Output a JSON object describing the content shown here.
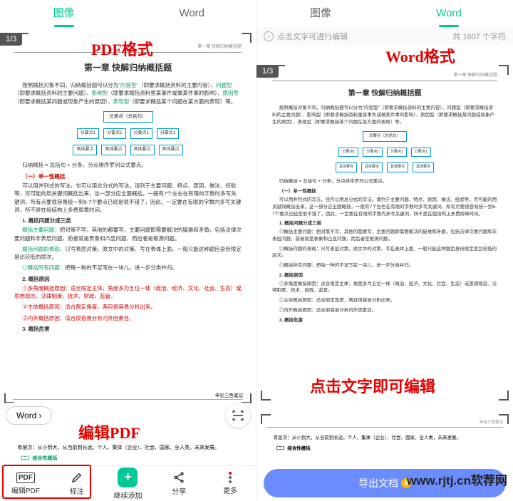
{
  "annotations": {
    "pdf_format": "PDF格式",
    "word_format": "Word格式",
    "click_to_edit": "点击文字即可编辑",
    "edit_pdf": "编辑PDF"
  },
  "watermark": "www.rjtj.cn软荐网",
  "left": {
    "tabs": {
      "image": "图像",
      "word": "Word",
      "active": "image"
    },
    "page_indicator": "1/3",
    "word_chip": "Word",
    "doc": {
      "header_line": "第一章  快解归纳概括题",
      "title": "第一章  快解归纳概括题",
      "intro": "按照概括对象不同，归纳概括题可以分为",
      "type1": "\"内容型\"",
      "type1_desc": "（即要求概括资料的主要内容）、",
      "type2": "问题型",
      "type2_desc": "（即要求概括资料的主要问题）、",
      "type3": "影响型",
      "type3_desc": "（即要求概括资料里某事件或做某件事的影响）、",
      "type4": "原因型",
      "type4_desc": "（即要求概括某问题或现象产生的原因）、",
      "type5": "表现型",
      "type5_desc": "（即要求概括某个问题在某方面的表现）等。",
      "diagram": {
        "top": "总要点（总括句）",
        "row2": [
          "分要点1",
          "分要点1",
          "分要点1",
          "分要点1"
        ],
        "row3": [
          "具体要点",
          "具体要点",
          "具体要点",
          "具体要点"
        ]
      },
      "formula": "归纳概括 = 总括句 + 分条，分点排序罗列公式要点。",
      "sec1": "（一）单一性概括",
      "sec1_p1": "可以用并列式的写法，也可以用总分式的写法。请列于主要问题、特点、原因、做法、经验等，尽可能的用关键词概括出来，这一部分应全面概括，一般有7个左右在有限的字数时多写关键词，所有点要很容易统一到6-7个要点已经是很不错了，因此，一定要在有限的字数内多写关键词，所不是在组结构上多费周章时间。",
      "sec2": "1. 概括问题分成三类",
      "sec2_l1_a": "概括主要问题：",
      "sec2_l1_b": "把对策不写，其他的都要写，主要问题即需要解决的疑难和矛盾，包括法律次要问题和非表层问题，前者就是表象和凸显问题，而后者是根源问题。",
      "sec2_l2_a": "概括问题的表现：",
      "sec2_l2_b": "只写表层对策，原文中的对策、写在表体上面、一般只能这种题目身份限定是比较低的层次。",
      "sec2_l3_a": "◎概括所有问题：",
      "sec2_l3_b": "把每一种的不足写在一块儿，进一步分类并归。",
      "sec3": "2. 概括原因",
      "sec3_l1": "①多角度概括原因：适合限定主体，角度多为五位一体（政治、经济、文化、社会、生态）或思想观念、法律制度、技术、财政、监管。",
      "sec3_l2": "②主体概括原因：适合限定角度，两目很容易分析出来。",
      "sec3_l3": "③内外概括原因：适合很容易分析内外因素目。",
      "sec4": "3. 概括危害",
      "note_title": "申论三色笔记",
      "p_last": "有层次：从小到大，从当前到长远。个人、集体（企业）、社会、国家、全人类。未来发展。",
      "sec_green": "（二）综合性概括"
    },
    "bottom_bar": {
      "edit_pdf": "编辑PDF",
      "annotate": "标注",
      "continue_add": "继续添加",
      "share": "分享",
      "more": "更多"
    }
  },
  "right": {
    "tabs": {
      "image": "图像",
      "word": "Word",
      "active": "word"
    },
    "info_text": "点击文字可进行编辑",
    "char_count": "共 1607 个字符",
    "page_indicator": "1/3",
    "doc": {
      "header_line": "第一章 快解归纳概括题",
      "title": "第一章 快解归纳概括题",
      "intro": "按照概括对象不同，归纳概括题可以分为\"内容型\"（即要求概括资料的主要内容）、问题型（即要求概括资料的主要问题）、影响型（即要求概括资料里某事件或做某件事的影响）、原因型（即要求概括某问题或现象产生的原因）、表现型（即要求概括某个问题在某方面的表现）等。",
      "diagram": {
        "top": "总要点（总括句）",
        "row2": [
          "分要点1",
          "分要点1",
          "分要点1",
          "分要点1"
        ],
        "row3": [
          "具体要点",
          "具体要点",
          "具体要点",
          "具体要点"
        ]
      },
      "formula": "归纳概括 = 总括句 + 分条，分点排序罗列公式要点。",
      "sec1": "（一）单一性概括",
      "sec1_p1": "可以用并列式的写法，也可以用总分式的写法。请列于主要问题、特点、原因、做法、经验等，尽可能的用关键词概括出来，这一部分应全面概括，一般有7个左右在有限的字数时多写关键词，所有点要很容易统一到6-7个要点已经是很不错了，因此，一定要在有限的字数内多写关键词，所不是在组结构上多费周章时间。",
      "sec2": "1. 概括问题分成三类",
      "sec2_p": "◎概括主要问题：把对策不写，其他的都要写，主要问题即需要解决的疑难和矛盾，包括法律次要问题和非表层问题，前者就是表象和凸显问题，而后者是根源问题。",
      "sec2_p2": "◎概括问题的表现：只写表层对策，原文中的对策、写在表体上面、一般只能这种题目身份限定是比较低的层次。",
      "sec2_p3": "◎概括所有问题：把每一种的不足写在一块儿，进一步分类并归。",
      "sec3": "2. 概括原因",
      "sec3_p1": "◎多角度概括原因：适合限定主体，角度多为五位一体（政治、经济、文化、社会、生态）或思想观念、法律制度、技术、财政、监管。",
      "sec3_p2": "◎主体概括原因：适合限定角度，两目很容易分析出来。",
      "sec3_p3": "◎内外概括原因：适合很容易分析内外因素目。",
      "sec4": "3. 概括危害",
      "note_title": "申论三色笔记",
      "p_last": "有层次：从小到大，从当前到长远，个人、集体（企业）、社会、国家、全人类，未来发展。",
      "sec_last": "（二）综合性概括"
    },
    "export_button": "导出文档"
  }
}
